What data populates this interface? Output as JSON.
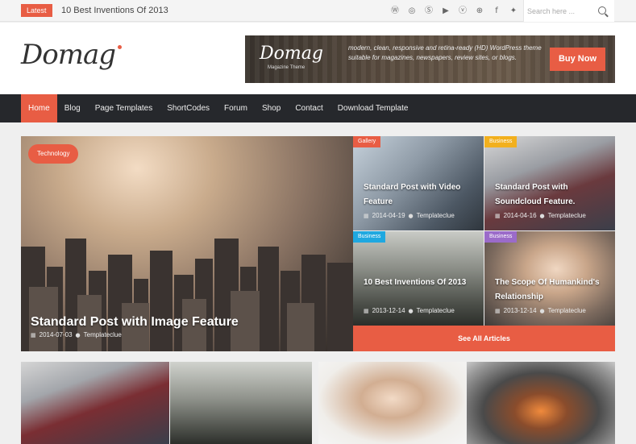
{
  "topbar": {
    "latest_label": "Latest",
    "latest_title": "10 Best Inventions Of 2013",
    "social_icons": [
      "wordpress-icon",
      "dribbble-icon",
      "skype-icon",
      "youtube-icon",
      "vimeo-icon",
      "rss-icon",
      "facebook-icon",
      "twitter-icon"
    ],
    "search_placeholder": "Search here ..."
  },
  "header": {
    "logo_text": "Domag",
    "banner": {
      "logo_text": "Domag",
      "logo_sub": "Magazine Theme",
      "text": "modern, clean, responsive and retina-ready (HD) WordPress theme suitable for magazines, newspapers, review sites, or blogs.",
      "button_label": "Buy Now"
    }
  },
  "nav": {
    "items": [
      "Home",
      "Blog",
      "Page Templates",
      "ShortCodes",
      "Forum",
      "Shop",
      "Contact",
      "Download Template"
    ],
    "active_index": 0
  },
  "featured": {
    "main": {
      "category": "Technology",
      "title": "Standard Post with Image Feature",
      "date": "2014-07-03",
      "author": "Templateclue"
    },
    "tiles": [
      {
        "category": "Gallery",
        "category_color": "#e85d44",
        "title": "Standard Post with Video Feature",
        "date": "2014-04-19",
        "author": "Templateclue"
      },
      {
        "category": "Business",
        "category_color": "#f2b01e",
        "title": "Standard Post with Soundcloud Feature.",
        "date": "2014-04-16",
        "author": "Templateclue"
      },
      {
        "category": "Business",
        "category_color": "#1fa8e0",
        "title": "10 Best Inventions Of 2013",
        "date": "2013-12-14",
        "author": "Templateclue"
      },
      {
        "category": "Business",
        "category_color": "#9b6bc9",
        "title": "The Scope Of Humankind's Relationship",
        "date": "2013-12-14",
        "author": "Templateclue"
      }
    ],
    "see_all_label": "See All Articles"
  },
  "colors": {
    "accent": "#e85d44",
    "nav_bg": "#26282c"
  }
}
